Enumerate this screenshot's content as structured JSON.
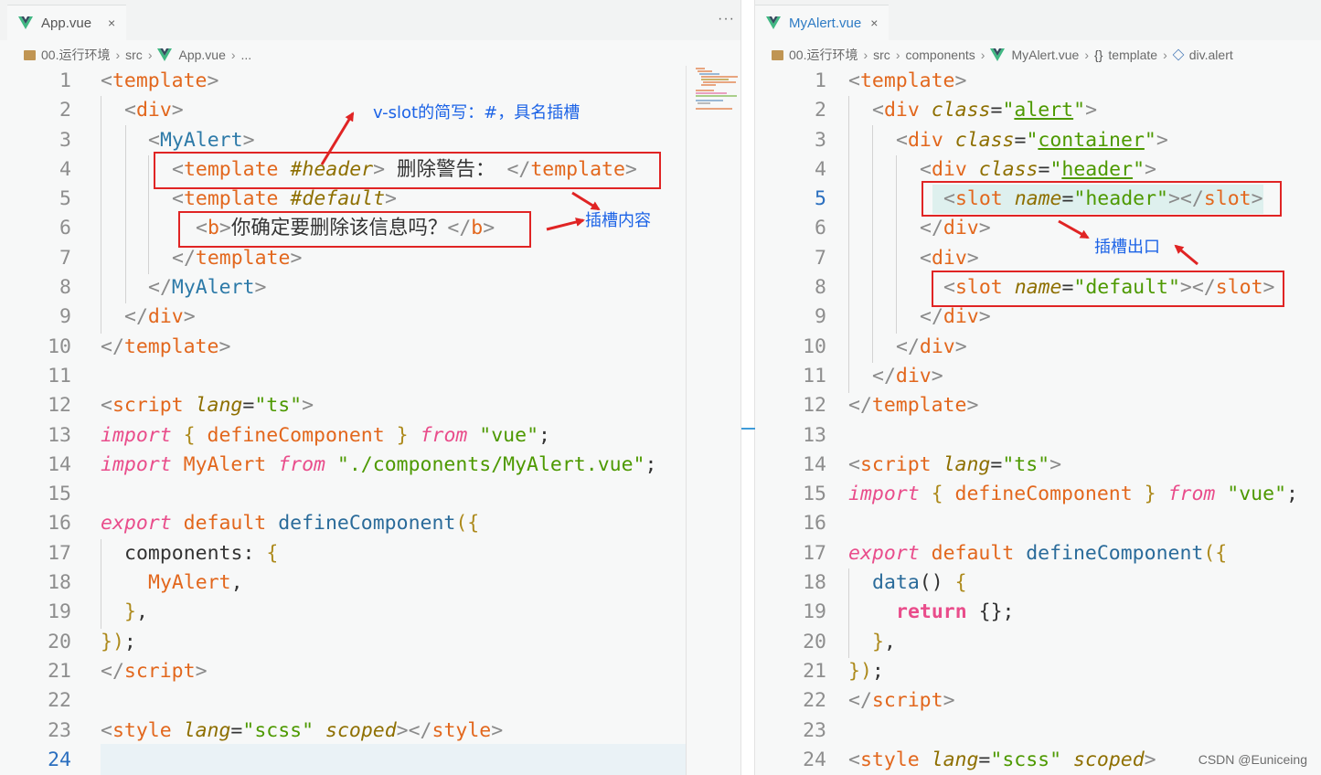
{
  "left": {
    "tab": {
      "label": "App.vue",
      "close": "×",
      "more": "···"
    },
    "breadcrumbs": [
      "00.运行环境",
      "src",
      "App.vue",
      "..."
    ],
    "active_line": "24"
  },
  "right": {
    "tab": {
      "label": "MyAlert.vue",
      "close": "×"
    },
    "breadcrumbs": [
      "00.运行环境",
      "src",
      "components",
      "MyAlert.vue",
      "template",
      "div.alert"
    ],
    "bracket_glyph": "{}",
    "active_line": "5"
  },
  "annotations": {
    "vslot": "v-slot的简写：#，具名插槽",
    "slot_content": "插槽内容",
    "slot_outlet": "插槽出口"
  },
  "colors": {
    "tag": "#e2671d",
    "punct": "#8a8a8a",
    "attr": "#8e6f00",
    "string": "#4d9900",
    "keyword": "#e94d8b",
    "box": "#e02424",
    "annotation": "#1c63e6"
  },
  "watermark": "CSDN @Euniceing"
}
